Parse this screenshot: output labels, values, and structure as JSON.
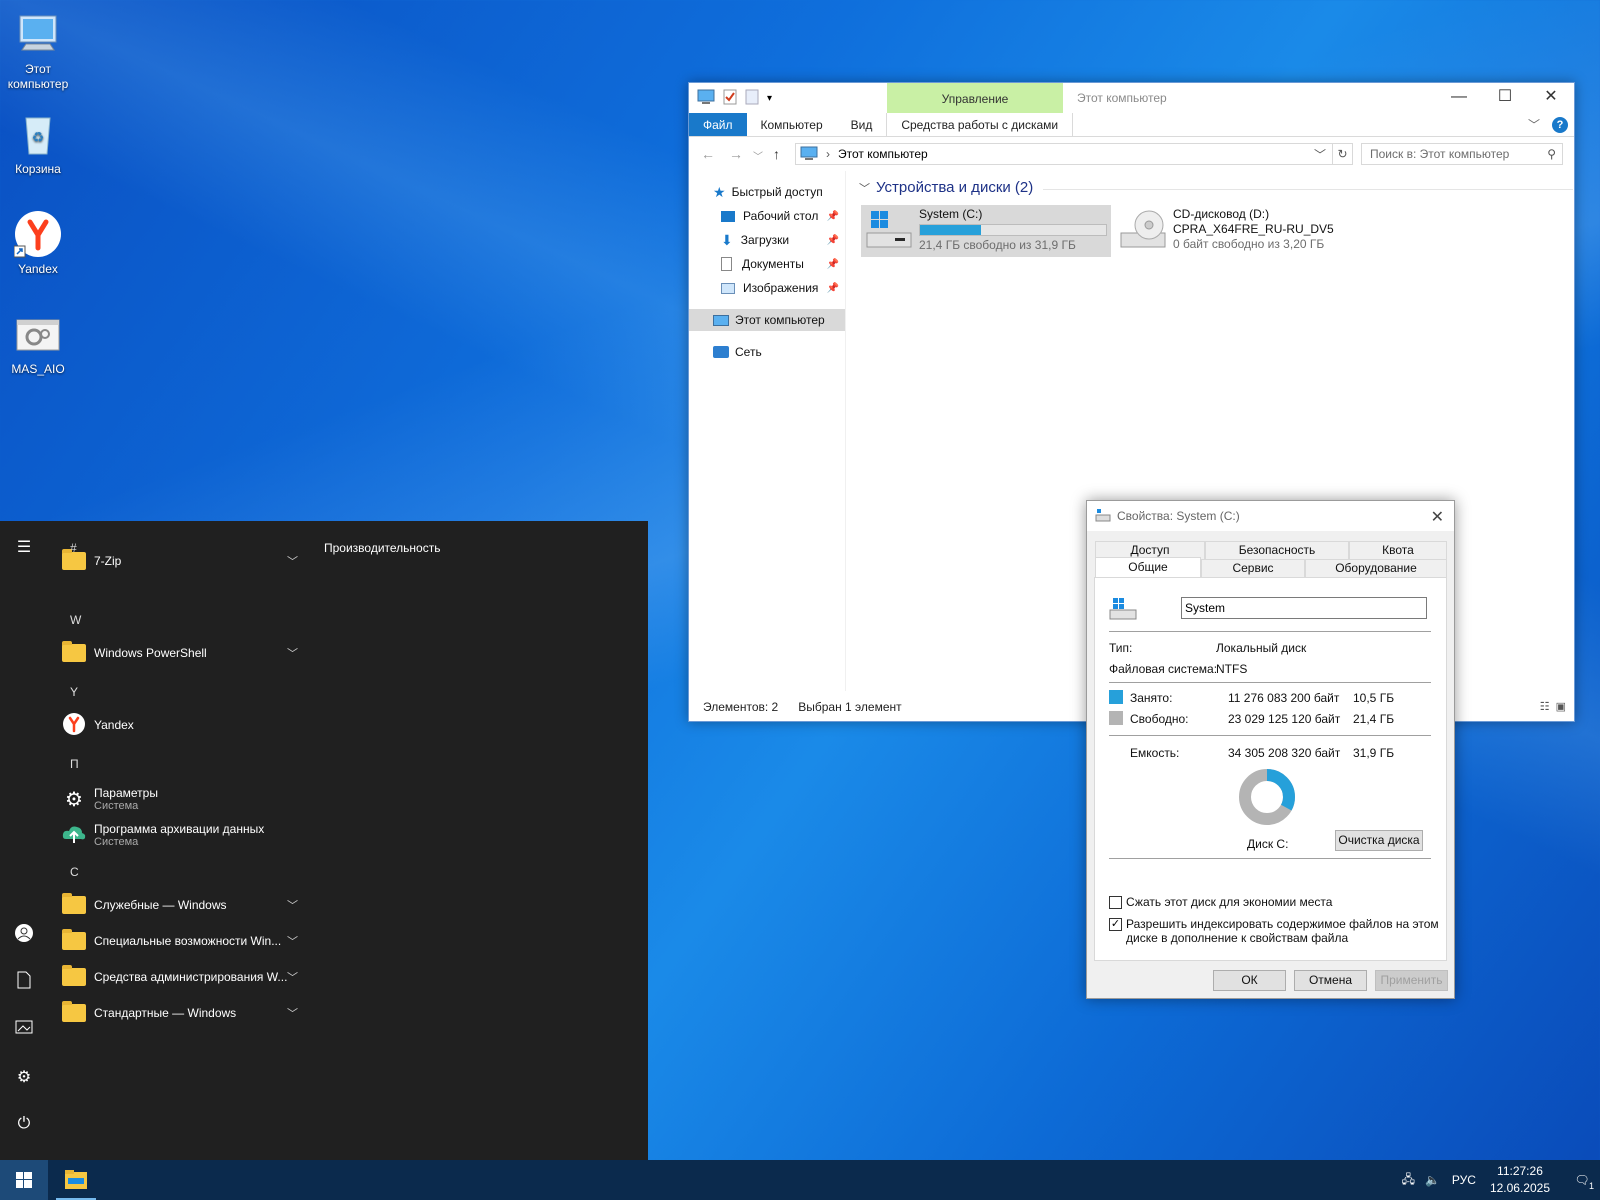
{
  "desktop": {
    "icons": [
      {
        "label": "Этот\nкомпьютер",
        "label1": "Этот",
        "label2": "компьютер",
        "icon": "computer-icon"
      },
      {
        "label": "Корзина",
        "icon": "recycle-bin-icon"
      },
      {
        "label": "Yandex",
        "icon": "yandex-icon"
      },
      {
        "label": "MAS_AIO",
        "icon": "script-file-icon"
      }
    ]
  },
  "explorer": {
    "title": "Этот компьютер",
    "manage_tab": "Управление",
    "ribbon_tabs": [
      "Файл",
      "Компьютер",
      "Вид",
      "Средства работы с дисками"
    ],
    "address": "Этот компьютер",
    "search_placeholder": "Поиск в: Этот компьютер",
    "nav": {
      "quick_access": "Быстрый доступ",
      "desktop": "Рабочий стол",
      "downloads": "Загрузки",
      "documents": "Документы",
      "pictures": "Изображения",
      "this_pc": "Этот компьютер",
      "network": "Сеть"
    },
    "group_header": "Устройства и диски (2)",
    "drives": [
      {
        "name": "System (C:)",
        "free_text": "21,4 ГБ свободно из 31,9 ГБ",
        "used_fraction": 0.33
      },
      {
        "name": "CD-дисковод (D:)",
        "label": "CPRA_X64FRE_RU-RU_DV5",
        "free_text": "0 байт свободно из 3,20 ГБ"
      }
    ],
    "status": {
      "items": "Элементов: 2",
      "selected": "Выбран 1 элемент"
    }
  },
  "properties": {
    "title": "Свойства: System (C:)",
    "tabs_top": [
      "Доступ",
      "Безопасность",
      "Квота"
    ],
    "tabs_bottom": [
      "Общие",
      "Сервис",
      "Оборудование"
    ],
    "volume_name": "System",
    "type_label": "Тип:",
    "type_value": "Локальный диск",
    "fs_label": "Файловая система:",
    "fs_value": "NTFS",
    "used_label": "Занято:",
    "used_bytes": "11 276 083 200 байт",
    "used_gb": "10,5 ГБ",
    "free_label": "Свободно:",
    "free_bytes": "23 029 125 120 байт",
    "free_gb": "21,4 ГБ",
    "capacity_label": "Емкость:",
    "capacity_bytes": "34 305 208 320 байт",
    "capacity_gb": "31,9 ГБ",
    "disk_label": "Диск C:",
    "cleanup_button": "Очистка диска",
    "compress_label": "Сжать этот диск для экономии места",
    "index_label1": "Разрешить индексировать содержимое файлов на этом",
    "index_label2": "диске в дополнение к свойствам файла",
    "ok": "ОК",
    "cancel": "Отмена",
    "apply": "Применить",
    "used_color": "#26a0da",
    "free_color": "#b4b4b4"
  },
  "start_menu": {
    "tiles_header": "Производительность",
    "letters": [
      "#",
      "W",
      "Y",
      "П",
      "С"
    ],
    "apps": {
      "zip": "7-Zip",
      "powershell": "Windows PowerShell",
      "yandex": "Yandex",
      "settings": "Параметры",
      "settings_sub": "Система",
      "backup": "Программа архивации данных",
      "backup_sub": "Система",
      "service": "Служебные — Windows",
      "accessibility": "Специальные возможности Win...",
      "admin": "Средства администрирования W...",
      "standard": "Стандартные — Windows"
    }
  },
  "taskbar": {
    "lang": "РУС",
    "time": "11:27:26",
    "date": "12.06.2025",
    "notif_count": "1"
  }
}
